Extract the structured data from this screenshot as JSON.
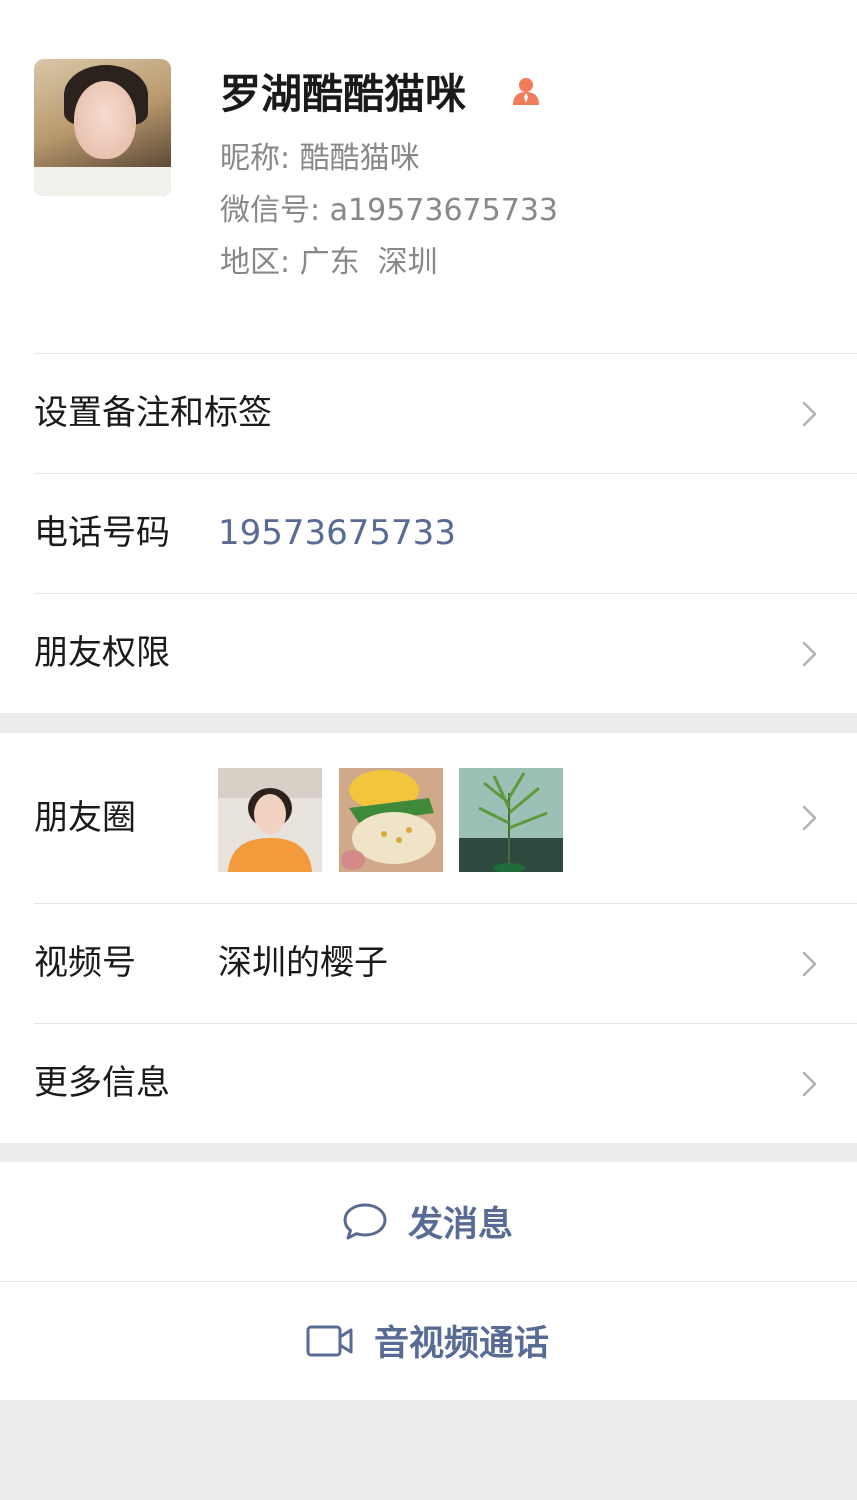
{
  "profile": {
    "name": "罗湖酷酷猫咪",
    "nickname_label": "昵称:",
    "nickname": "酷酷猫咪",
    "wechat_id_label": "微信号:",
    "wechat_id": "a19573675733",
    "region_label": "地区:",
    "region_province": "广东",
    "region_city": "深圳",
    "badge_icon": "star-friend-icon",
    "badge_color": "#f07c5a"
  },
  "cells": {
    "remark": {
      "label": "设置备注和标签"
    },
    "phone": {
      "label": "电话号码",
      "value": "19573675733"
    },
    "permission": {
      "label": "朋友权限"
    },
    "moments": {
      "label": "朋友圈"
    },
    "channels": {
      "label": "视频号",
      "value": "深圳的樱子"
    },
    "more": {
      "label": "更多信息"
    }
  },
  "actions": {
    "message": {
      "label": "发消息",
      "icon": "chat-bubble-icon"
    },
    "call": {
      "label": "音视频通话",
      "icon": "video-camera-icon"
    }
  },
  "colors": {
    "link": "#576b95",
    "background": "#ededed",
    "divider": "#e5e5e5"
  }
}
